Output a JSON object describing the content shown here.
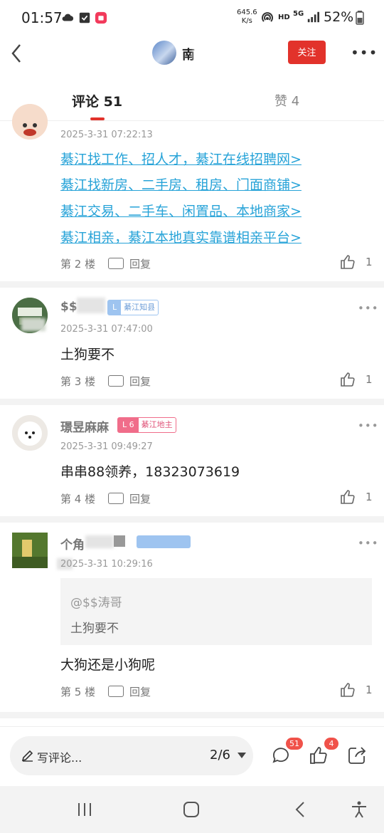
{
  "status_bar": {
    "time": "01:57",
    "net_speed_value": "645.6",
    "net_speed_unit": "K/s",
    "hd": "HD",
    "network": "5G",
    "battery": "52%"
  },
  "header": {
    "username": "南",
    "follow_label": "关注",
    "more": "•••"
  },
  "tabs": {
    "comments_label": "评论 51",
    "likes_label": "赞 4"
  },
  "comments": [
    {
      "time": "2025-3-31 07:22:13",
      "links": [
        "綦江找工作、招人才，綦江在线招聘网>",
        "綦江找新房、二手房、租房、门面商铺>",
        "綦江交易、二手车、闲置品、本地商家>",
        "綦江相亲，綦江本地真实靠谱相亲平台>"
      ],
      "floor": "第 2 楼",
      "reply": "回复",
      "likes": "1"
    },
    {
      "name": "$$",
      "badge": "L",
      "badge_title": "綦江知县",
      "time": "2025-3-31 07:47:00",
      "text": "土狗要不",
      "floor": "第 3 楼",
      "reply": "回复",
      "likes": "1",
      "more": "•••"
    },
    {
      "name": "璟昱麻麻",
      "badge": "L 6",
      "badge_title": "綦江地主",
      "time": "2025-3-31 09:49:27",
      "text": "串串88领养，18323073619",
      "floor": "第 4 楼",
      "reply": "回复",
      "likes": "1",
      "more": "•••"
    },
    {
      "name": "个角",
      "time": "2025-3-31 10:29:16",
      "quote_name": "@$$涛哥",
      "quote_text": "土狗要不",
      "text": "大狗还是小狗呢",
      "floor": "第 5 楼",
      "reply": "回复",
      "likes": "1",
      "more": "•••"
    }
  ],
  "bottom_bar": {
    "write_placeholder": "写评论...",
    "page": "2/6",
    "comments_count": "51",
    "likes_count": "4"
  },
  "colors": {
    "accent": "#e2322b",
    "link": "#27a3d8",
    "badge_pink": "#f06d8a",
    "badge_blue": "#9ec4f0"
  }
}
